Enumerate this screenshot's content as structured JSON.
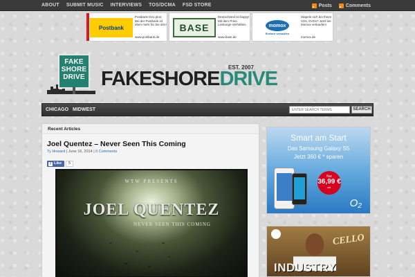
{
  "topbar": {
    "nav": [
      {
        "label": "About"
      },
      {
        "label": "Submit Music"
      },
      {
        "label": "Interviews"
      },
      {
        "label": "TOS/DCMA"
      },
      {
        "label": "FSD Store"
      }
    ],
    "feeds": [
      {
        "label": "Posts",
        "icon": "rss-icon"
      },
      {
        "label": "Comments",
        "icon": "rss-icon"
      }
    ]
  },
  "ads": [
    {
      "logo": "Postbank",
      "text": "Postbank Giro plus: Bei der Postbank ist eben mehr für Sie drin!",
      "url": "www.postbank.de"
    },
    {
      "logo": "BASE",
      "text": "Deutschland ist happy! Mit dem Preis-Leistungs-Verhältnis.",
      "url": "www.base.de"
    },
    {
      "logo": "momox",
      "tag": "Einfach verkaufen",
      "text": "Stapeln sich bei Ihnen CDs, DVDs? Jetzt bei Momox verkaufen!",
      "url": "momox.de"
    }
  ],
  "logo": {
    "sign_line1": "FAKE",
    "sign_line2": "SHORE",
    "sign_line3": "DRIVE",
    "word1": "FAKESHORE",
    "word2": "DRIVE",
    "est": "EST. 2007"
  },
  "mainnav": {
    "items": [
      {
        "label": "Chicago"
      },
      {
        "label": "Midwest"
      }
    ],
    "search_placeholder": "ENTER SEARCH TERMS",
    "search_button": "SEARCH"
  },
  "content": {
    "section_title": "Recent Articles",
    "post": {
      "title": "Joel Quentez – Never Seen This Coming",
      "author": "Ty Howard",
      "date": "June 16, 2014",
      "comments": "0 Comments",
      "like_label": "Like",
      "like_count": "5",
      "cover": {
        "presents": "WTW PRESENTS",
        "artist": "JOEL QUENTEZ",
        "subtitle": "NEVER SEEN THIS COMING"
      }
    }
  },
  "sidebar": {
    "ad1": {
      "headline": "Smart am Start",
      "line2": "Das Samsung Galaxy S5",
      "line3": "Jetzt 360 € * sparen",
      "price_prefix": "Nur",
      "price": "36,99 €",
      "price_suffix": "mtl.",
      "brand": "O₂"
    },
    "ad2": {
      "artist": "CELLO",
      "headline": "INDUSTRY"
    }
  },
  "colors": {
    "accent_teal": "#2a8a7a",
    "nav_dark": "#3a3a3a",
    "link_blue": "#2d6aa8",
    "rss_orange": "#f08a1c"
  }
}
